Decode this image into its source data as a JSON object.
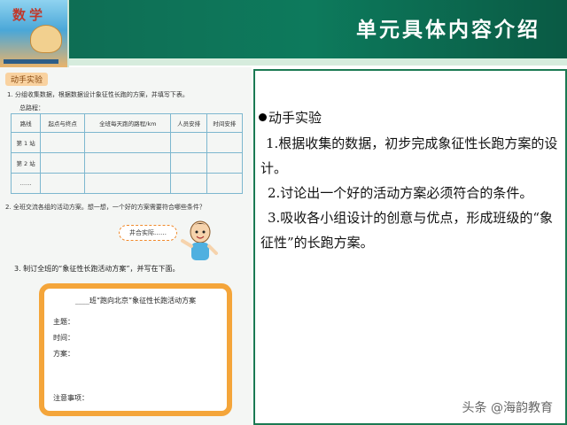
{
  "header": {
    "title": "单元具体内容介绍",
    "cover_title": "数学"
  },
  "left_doc": {
    "tag": "动手实验",
    "q1": "1. 分组收集数据，根据数据设计象征性长跑的方案，并填写下表。",
    "route_label": "总路程：",
    "table": {
      "headers": [
        "路线",
        "起点与终点",
        "全班每天跑的路程/km",
        "人员安排",
        "时间安排"
      ],
      "rows": [
        [
          "第 1 站",
          "",
          "",
          "",
          ""
        ],
        [
          "第 2 站",
          "",
          "",
          "",
          ""
        ],
        [
          "……",
          "",
          "",
          "",
          ""
        ]
      ]
    },
    "q2": "2. 全班交流各组的活动方案。想一想，一个好的方案需要符合哪些条件？",
    "speech": "井合实际……",
    "q3": "3. 制订全班的“象征性长跑活动方案”，并写在下面。",
    "plan": {
      "title": "____班“跑向北京”象征性长跑活动方案",
      "topic": "主题：",
      "time": "时间：",
      "plan": "方案：",
      "notes": "注意事项："
    }
  },
  "panel": {
    "heading": "动手实验",
    "p1": "1.根据收集的数据，初步完成象征性长跑方案的设计。",
    "p2": "2.讨论出一个好的活动方案必须符合的条件。",
    "p3": "3.吸收各小组设计的创意与优点，形成班级的“象征性”的长跑方案。"
  },
  "watermark": "头条 @海韵教育",
  "colors": {
    "header_green": "#0d7a5c",
    "panel_border": "#1b7a53",
    "plan_border": "#f4a53a"
  }
}
